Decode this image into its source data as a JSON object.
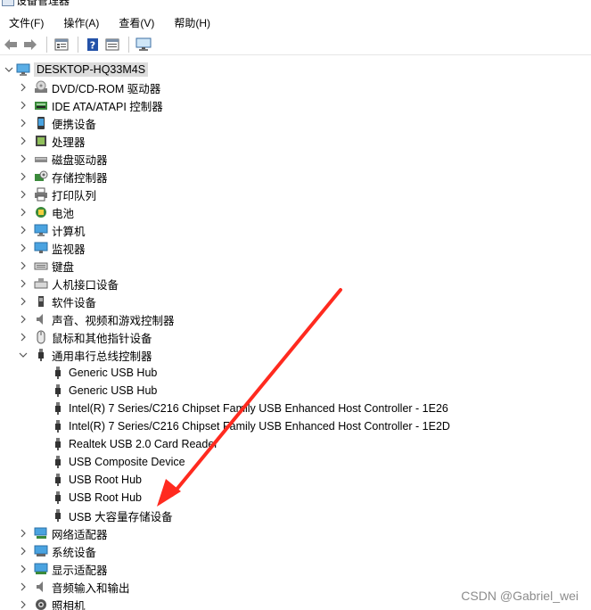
{
  "title": "设备管理器",
  "menu": [
    "文件(F)",
    "操作(A)",
    "查看(V)",
    "帮助(H)"
  ],
  "toolbar": [
    "back-icon",
    "forward-icon",
    "properties-icon",
    "help-icon",
    "view-icon",
    "monitor-icon"
  ],
  "root": "DESKTOP-HQ33M4S",
  "categories": [
    {
      "label": "DVD/CD-ROM 驱动器",
      "icon": "dvd-drive-icon"
    },
    {
      "label": "IDE ATA/ATAPI 控制器",
      "icon": "ide-controller-icon"
    },
    {
      "label": "便携设备",
      "icon": "portable-device-icon"
    },
    {
      "label": "处理器",
      "icon": "processor-icon"
    },
    {
      "label": "磁盘驱动器",
      "icon": "disk-drive-icon"
    },
    {
      "label": "存储控制器",
      "icon": "storage-controller-icon"
    },
    {
      "label": "打印队列",
      "icon": "printer-icon"
    },
    {
      "label": "电池",
      "icon": "battery-icon"
    },
    {
      "label": "计算机",
      "icon": "computer-icon"
    },
    {
      "label": "监视器",
      "icon": "monitor-icon"
    },
    {
      "label": "键盘",
      "icon": "keyboard-icon"
    },
    {
      "label": "人机接口设备",
      "icon": "hid-icon"
    },
    {
      "label": "软件设备",
      "icon": "software-device-icon"
    },
    {
      "label": "声音、视频和游戏控制器",
      "icon": "sound-icon"
    },
    {
      "label": "鼠标和其他指针设备",
      "icon": "mouse-icon"
    },
    {
      "label": "通用串行总线控制器",
      "icon": "usb-icon",
      "expanded": true,
      "children": [
        "Generic USB Hub",
        "Generic USB Hub",
        "Intel(R) 7 Series/C216 Chipset Family USB Enhanced Host Controller - 1E26",
        "Intel(R) 7 Series/C216 Chipset Family USB Enhanced Host Controller - 1E2D",
        "Realtek USB 2.0 Card Reader",
        "USB Composite Device",
        "USB Root Hub",
        "USB Root Hub",
        "USB 大容量存储设备"
      ]
    },
    {
      "label": "网络适配器",
      "icon": "network-adapter-icon"
    },
    {
      "label": "系统设备",
      "icon": "system-device-icon"
    },
    {
      "label": "显示适配器",
      "icon": "display-adapter-icon"
    },
    {
      "label": "音频输入和输出",
      "icon": "audio-io-icon"
    },
    {
      "label": "照相机",
      "icon": "camera-icon"
    }
  ],
  "watermark": "CSDN @Gabriel_wei",
  "annotation": {
    "color": "#ff2a1f",
    "points_to": "USB 大容量存储设备"
  }
}
